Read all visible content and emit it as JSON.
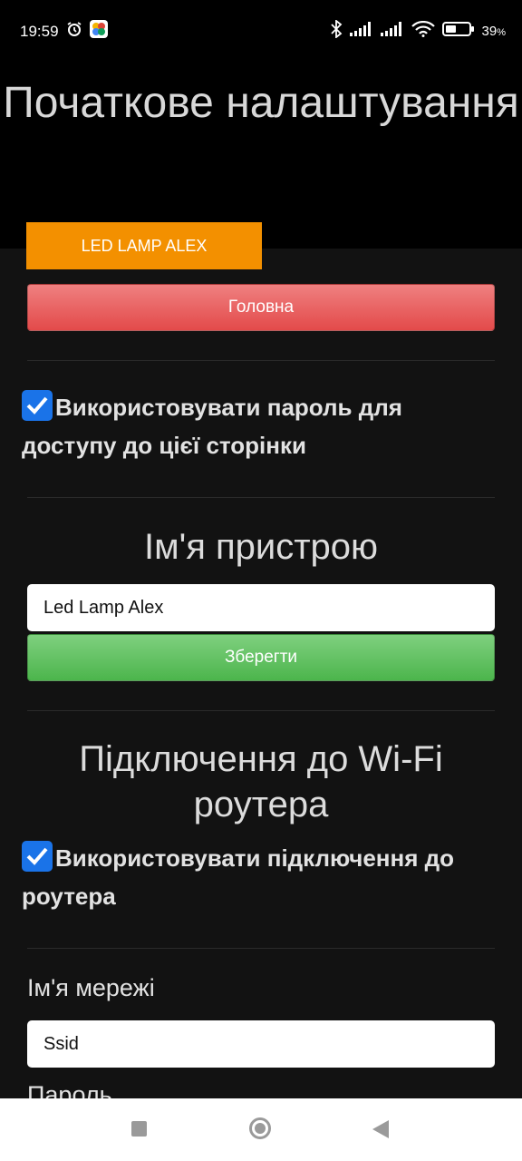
{
  "status_bar": {
    "time": "19:59",
    "battery_percent": "39",
    "battery_suffix": "%",
    "icons": [
      "alarm-icon",
      "pinwheel-app-icon",
      "bluetooth-icon",
      "signal-icon",
      "signal-icon",
      "wifi-icon",
      "battery-icon"
    ]
  },
  "page": {
    "title": "Початкове налаштування",
    "device_badge": "LED LAMP ALEX",
    "home_button": "Головна"
  },
  "password_option": {
    "checked": true,
    "label": "Використовувати пароль для доступу до цієї сторінки"
  },
  "device_name": {
    "heading": "Ім'я пристрою",
    "value": "Led Lamp Alex",
    "save_button": "Зберегти"
  },
  "wifi": {
    "heading": "Підключення до Wi-Fi роутера",
    "use_router_checked": true,
    "use_router_label": "Використовувати підключення до роутера",
    "network_label": "Ім'я мережі",
    "ssid_value": "Ssid",
    "password_label": "Пароль"
  },
  "colors": {
    "badge": "#f39000",
    "home_button": "#e34a4a",
    "save_button": "#4cb54c",
    "checkbox": "#1a73e8"
  }
}
